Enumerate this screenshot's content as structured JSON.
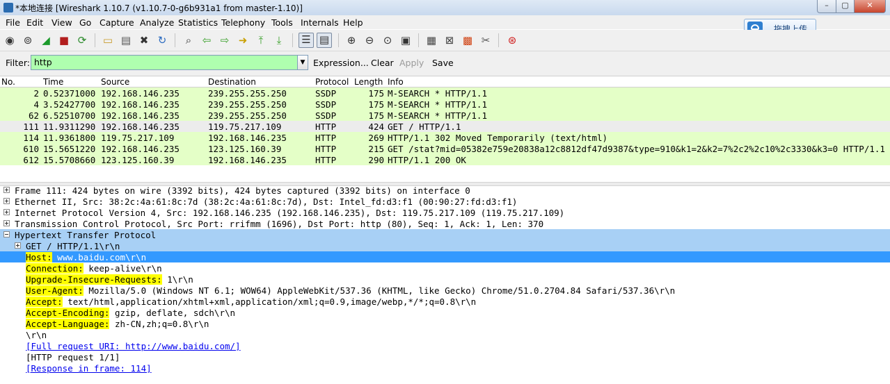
{
  "window": {
    "title": "*本地连接   [Wireshark 1.10.7  (v1.10.7-0-g6b931a1 from master-1.10)]",
    "min": "–",
    "max": "▢",
    "close": "✕"
  },
  "menu": [
    "File",
    "Edit",
    "View",
    "Go",
    "Capture",
    "Analyze",
    "Statistics",
    "Telephony",
    "Tools",
    "Internals",
    "Help"
  ],
  "upload_button": {
    "label": "拖拽上传"
  },
  "filter": {
    "label": "Filter:",
    "value": "http",
    "expression": "Expression...",
    "clear": "Clear",
    "apply": "Apply",
    "save": "Save",
    "bg_color": "#afffaf"
  },
  "packet_list": {
    "headers": {
      "no": "No.",
      "time": "Time",
      "source": "Source",
      "destination": "Destination",
      "protocol": "Protocol",
      "length": "Length",
      "info": "Info"
    },
    "rows": [
      {
        "no": "2",
        "time": "0.52371000",
        "source": "192.168.146.235",
        "destination": "239.255.255.250",
        "protocol": "SSDP",
        "length": "175",
        "info": "M-SEARCH * HTTP/1.1",
        "color": "#e4ffc7"
      },
      {
        "no": "4",
        "time": "3.52427700",
        "source": "192.168.146.235",
        "destination": "239.255.255.250",
        "protocol": "SSDP",
        "length": "175",
        "info": "M-SEARCH * HTTP/1.1",
        "color": "#e4ffc7"
      },
      {
        "no": "62",
        "time": "6.52510700",
        "source": "192.168.146.235",
        "destination": "239.255.255.250",
        "protocol": "SSDP",
        "length": "175",
        "info": "M-SEARCH * HTTP/1.1",
        "color": "#e4ffc7"
      },
      {
        "no": "111",
        "time": "11.9311290",
        "source": "192.168.146.235",
        "destination": "119.75.217.109",
        "protocol": "HTTP",
        "length": "424",
        "info": "GET / HTTP/1.1",
        "color": "#ececec"
      },
      {
        "no": "114",
        "time": "11.9361800",
        "source": "119.75.217.109",
        "destination": "192.168.146.235",
        "protocol": "HTTP",
        "length": "269",
        "info": "HTTP/1.1 302 Moved Temporarily  (text/html)",
        "color": "#e4ffc7"
      },
      {
        "no": "610",
        "time": "15.5651220",
        "source": "192.168.146.235",
        "destination": "123.125.160.39",
        "protocol": "HTTP",
        "length": "215",
        "info": "GET /stat?mid=05382e759e20838a12c8812df47d9387&type=910&k1=2&k2=7%2c2%2c10%2c3330&k3=0 HTTP/1.1",
        "color": "#e4ffc7"
      },
      {
        "no": "612",
        "time": "15.5708660",
        "source": "123.125.160.39",
        "destination": "192.168.146.235",
        "protocol": "HTTP",
        "length": "290",
        "info": "HTTP/1.1 200 OK",
        "color": "#e4ffc7"
      }
    ]
  },
  "details": {
    "frame": "Frame 111: 424 bytes on wire (3392 bits), 424 bytes captured (3392 bits) on interface 0",
    "ethernet": "Ethernet II, Src: 38:2c:4a:61:8c:7d (38:2c:4a:61:8c:7d), Dst: Intel_fd:d3:f1 (00:90:27:fd:d3:f1)",
    "ip": "Internet Protocol Version 4, Src: 192.168.146.235 (192.168.146.235), Dst: 119.75.217.109 (119.75.217.109)",
    "tcp": "Transmission Control Protocol, Src Port: rrifmm (1696), Dst Port: http (80), Seq: 1, Ack: 1, Len: 370",
    "http": "Hypertext Transfer Protocol",
    "get": "GET / HTTP/1.1\\r\\n",
    "fields": [
      {
        "key": "Host:",
        "value": " www.baidu.com\\r\\n"
      },
      {
        "key": "Connection:",
        "value": " keep-alive\\r\\n"
      },
      {
        "key": "Upgrade-Insecure-Requests:",
        "value": " 1\\r\\n"
      },
      {
        "key": "User-Agent:",
        "value": " Mozilla/5.0 (Windows NT 6.1; WOW64) AppleWebKit/537.36 (KHTML, like Gecko) Chrome/51.0.2704.84 Safari/537.36\\r\\n"
      },
      {
        "key": "Accept:",
        "value": " text/html,application/xhtml+xml,application/xml;q=0.9,image/webp,*/*;q=0.8\\r\\n"
      },
      {
        "key": "Accept-Encoding:",
        "value": " gzip, deflate, sdch\\r\\n"
      },
      {
        "key": "Accept-Language:",
        "value": " zh-CN,zh;q=0.8\\r\\n"
      }
    ],
    "crlf": "\\r\\n",
    "full_uri": "[Full request URI: http://www.baidu.com/]",
    "request_no": "[HTTP request 1/1]",
    "response_in": "[Response in frame: 114]"
  },
  "icons": [
    "interface-list-icon",
    "options-icon",
    "start-capture-icon",
    "stop-capture-icon",
    "restart-capture-icon",
    "open-file-icon",
    "save-file-icon",
    "close-file-icon",
    "reload-icon",
    "find-icon",
    "go-back-icon",
    "go-forward-icon",
    "go-to-packet-icon",
    "first-packet-icon",
    "last-packet-icon",
    "colorize-icon",
    "auto-scroll-icon",
    "zoom-in-icon",
    "zoom-out-icon",
    "normal-size-icon",
    "resize-columns-icon",
    "capture-filters-icon",
    "display-filters-icon",
    "coloring-rules-icon",
    "preferences-icon",
    "help-icon"
  ]
}
